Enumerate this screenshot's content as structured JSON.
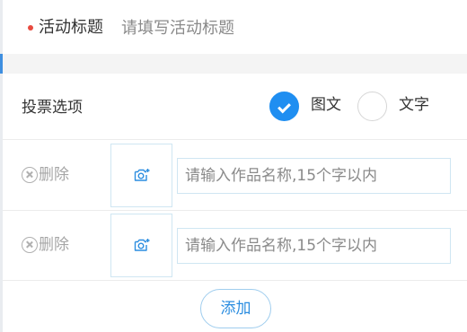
{
  "title_row": {
    "label": "活动标题",
    "placeholder": "请填写活动标题",
    "value": ""
  },
  "vote_options": {
    "label": "投票选项",
    "choices": [
      {
        "label": "图文",
        "selected": true
      },
      {
        "label": "文字",
        "selected": false
      }
    ]
  },
  "options": [
    {
      "delete_label": "删除",
      "upload_icon": "camera-plus-icon",
      "name_placeholder": "请输入作品名称,15个字以内",
      "name_value": ""
    },
    {
      "delete_label": "删除",
      "upload_icon": "camera-plus-icon",
      "name_placeholder": "请输入作品名称,15个字以内",
      "name_value": ""
    }
  ],
  "add_button": {
    "label": "添加"
  },
  "colors": {
    "accent": "#1f8ef1",
    "required_dot": "#e84a3f",
    "input_border": "#cfe6f2",
    "muted_text": "#a6a6a6"
  }
}
